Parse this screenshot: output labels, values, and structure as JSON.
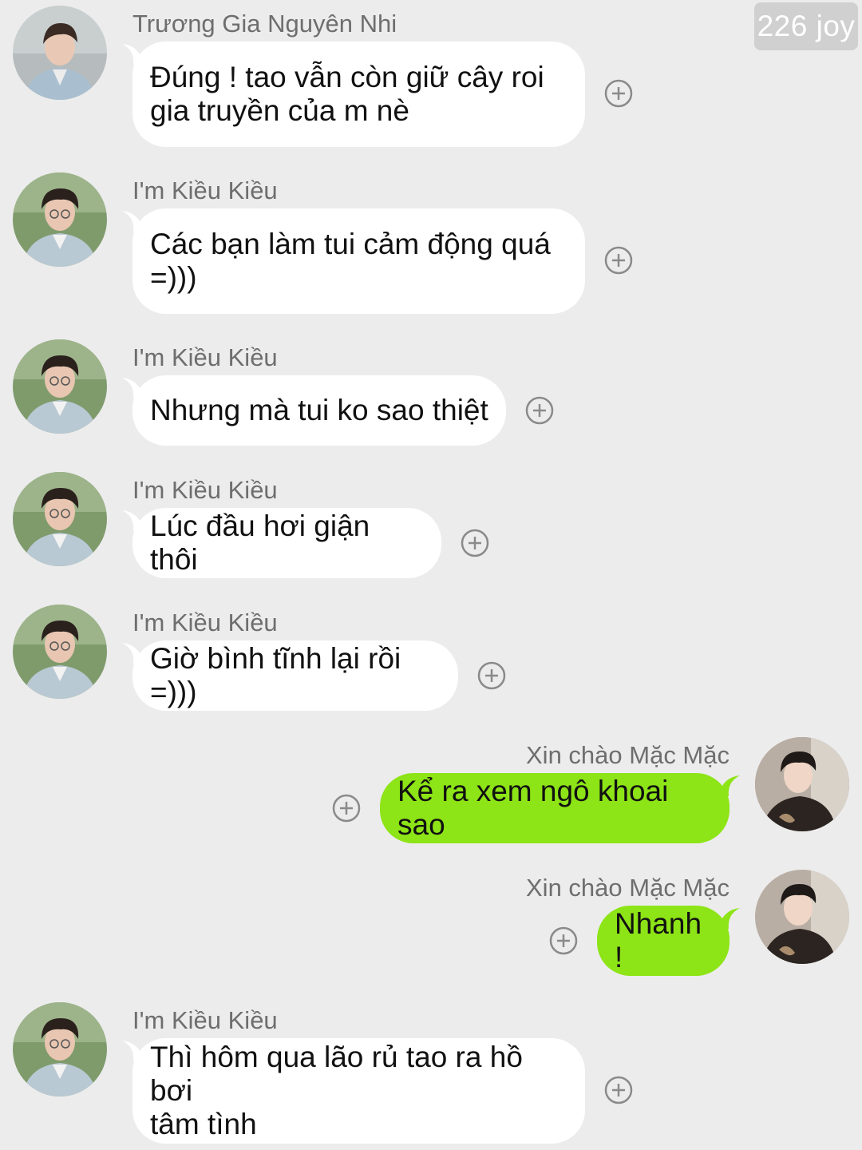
{
  "badge": "226 joy",
  "messages": [
    {
      "sender": "Trương Gia Nguyên Nhi",
      "lines": [
        "Đúng ! tao vẫn còn giữ cây roi",
        "gia truyền của m nè"
      ]
    },
    {
      "sender": "I'm Kiều Kiều",
      "lines": [
        "Các bạn làm tui cảm động quá",
        "=)))"
      ]
    },
    {
      "sender": "I'm Kiều Kiều",
      "lines": [
        "Nhưng mà tui ko sao thiệt"
      ]
    },
    {
      "sender": "I'm Kiều Kiều",
      "lines": [
        "Lúc đầu hơi giận thôi"
      ]
    },
    {
      "sender": "I'm Kiều Kiều",
      "lines": [
        "Giờ bình tĩnh lại rồi =)))"
      ]
    },
    {
      "sender": "Xin chào Mặc Mặc",
      "lines": [
        "Kể ra xem ngô khoai sao"
      ]
    },
    {
      "sender": "Xin chào Mặc Mặc",
      "lines": [
        "Nhanh !"
      ]
    },
    {
      "sender": "I'm Kiều Kiều",
      "lines": [
        "Thì hôm qua lão rủ tao ra hồ bơi",
        "tâm tình"
      ]
    }
  ],
  "icons": {
    "add": "plus-circle-icon",
    "avatar": "user-avatar"
  },
  "colors": {
    "background": "#ececec",
    "incoming_bubble": "#ffffff",
    "outgoing_bubble": "#8de416",
    "sender_text": "#6e6e6e"
  }
}
